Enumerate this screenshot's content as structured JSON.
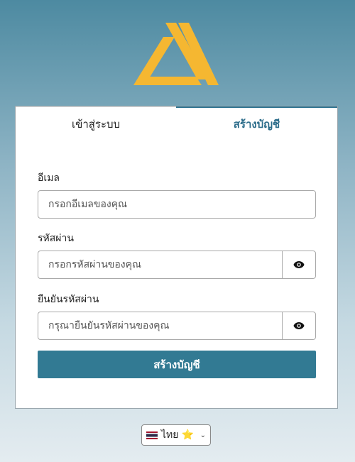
{
  "tabs": {
    "login": "เข้าสู่ระบบ",
    "signup": "สร้างบัญชี"
  },
  "form": {
    "email_label": "อีเมล",
    "email_placeholder": "กรอกอีเมลของคุณ",
    "password_label": "รหัสผ่าน",
    "password_placeholder": "กรอกรหัสผ่านของคุณ",
    "confirm_label": "ยืนยันรหัสผ่าน",
    "confirm_placeholder": "กรุณายืนยันรหัสผ่านของคุณ",
    "submit_label": "สร้างบัญชี"
  },
  "language": {
    "selected": "ไทย ⭐"
  },
  "colors": {
    "accent": "#327a93",
    "logo": "#f5b731",
    "tab_active_text": "#2b6c8a"
  }
}
